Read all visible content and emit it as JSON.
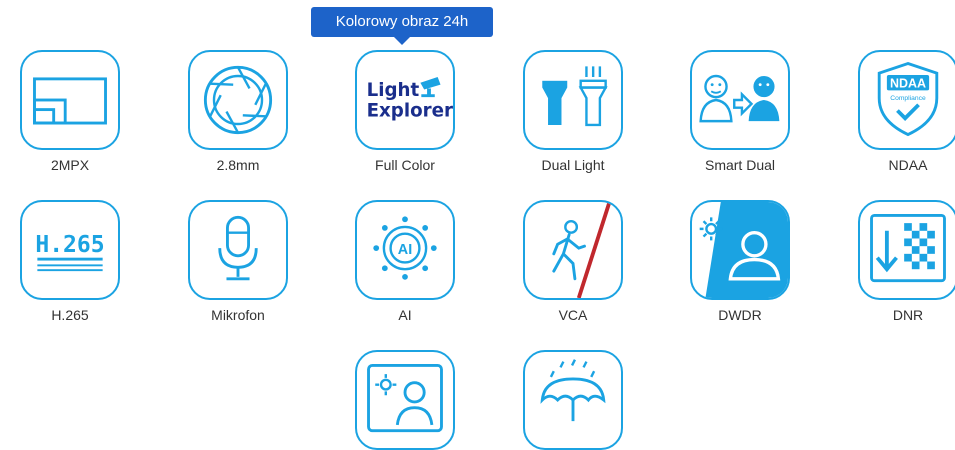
{
  "tooltip": "Kolorowy obraz 24h",
  "accent": "#1ba3e2",
  "tooltip_color": "#1d63c9",
  "features": [
    {
      "label": "2MPX",
      "icon": "resolution-icon"
    },
    {
      "label": "2.8mm",
      "icon": "aperture-icon"
    },
    {
      "label": "Full Color",
      "icon": "light-explorer-icon",
      "icon_text": [
        "Light",
        "Explorer"
      ]
    },
    {
      "label": "Dual Light",
      "icon": "dual-light-icon"
    },
    {
      "label": "Smart Dual",
      "icon": "smart-dual-icon"
    },
    {
      "label": "NDAA",
      "icon": "ndaa-shield-icon",
      "icon_text": [
        "NDAA",
        "Compliance"
      ]
    },
    {
      "label": "H.265",
      "icon": "h265-icon",
      "icon_text": "H.265"
    },
    {
      "label": "Mikrofon",
      "icon": "microphone-icon"
    },
    {
      "label": "AI",
      "icon": "ai-chip-icon",
      "icon_text": "AI"
    },
    {
      "label": "VCA",
      "icon": "vca-icon"
    },
    {
      "label": "DWDR",
      "icon": "dwdr-icon"
    },
    {
      "label": "DNR",
      "icon": "dnr-icon"
    },
    {
      "label": "",
      "icon": "sun-person-icon"
    },
    {
      "label": "",
      "icon": "umbrella-rain-icon"
    }
  ]
}
